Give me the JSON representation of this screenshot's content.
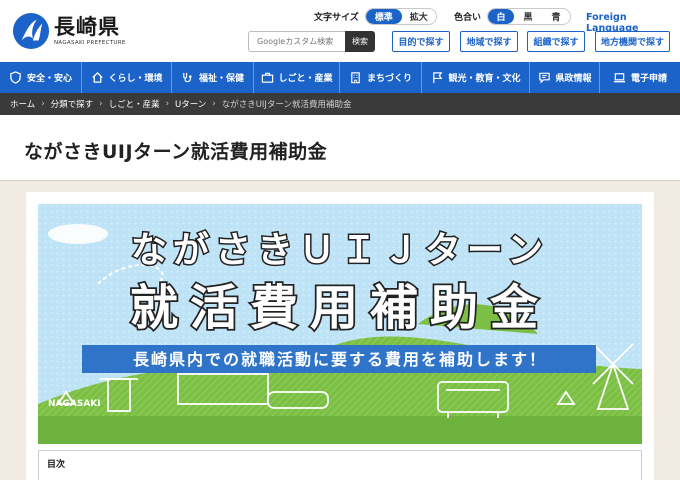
{
  "header": {
    "logo_main": "長崎県",
    "logo_sub": "NAGASAKI PREFECTURE",
    "font_size": {
      "label": "文字サイズ",
      "options": [
        "標準",
        "拡大"
      ],
      "selected": "標準"
    },
    "color": {
      "label": "色合い",
      "options": [
        "白",
        "黒",
        "青"
      ],
      "selected": "白"
    },
    "foreign_language": "Foreign Language",
    "search": {
      "placeholder": "Googleカスタム検索",
      "button": "検索"
    },
    "find_buttons": [
      "目的で探す",
      "地域で探す",
      "組織で探す",
      "地方機関で探す"
    ]
  },
  "nav": {
    "items": [
      {
        "label": "安全・安心",
        "icon": "shield-icon"
      },
      {
        "label": "くらし・環境",
        "icon": "house-icon"
      },
      {
        "label": "福祉・保健",
        "icon": "stethoscope-icon"
      },
      {
        "label": "しごと・産業",
        "icon": "briefcase-icon"
      },
      {
        "label": "まちづくり",
        "icon": "building-icon"
      },
      {
        "label": "観光・教育・文化",
        "icon": "flag-icon"
      },
      {
        "label": "県政情報",
        "icon": "chat-icon"
      },
      {
        "label": "電子申請",
        "icon": "laptop-icon"
      }
    ]
  },
  "breadcrumb": [
    "ホーム",
    "分類で探す",
    "しごと・産業",
    "Uターン",
    "ながさきUIJターン就活費用補助金"
  ],
  "page": {
    "title": "ながさきUIJターン就活費用補助金"
  },
  "banner": {
    "line1": "ながさきＵＩＪターン",
    "line2": "就活費用補助金",
    "subtitle": "長崎県内での就職活動に要する費用を補助します！",
    "town_label": "NAGASAKI"
  },
  "toc": {
    "label": "目次"
  },
  "colors": {
    "brand_blue": "#1b63c8",
    "breadcrumb_bg": "#3a3a3a",
    "page_bg": "#f1ebe3",
    "banner_sky": "#bfe3f6",
    "banner_green": "#7cbf45"
  }
}
